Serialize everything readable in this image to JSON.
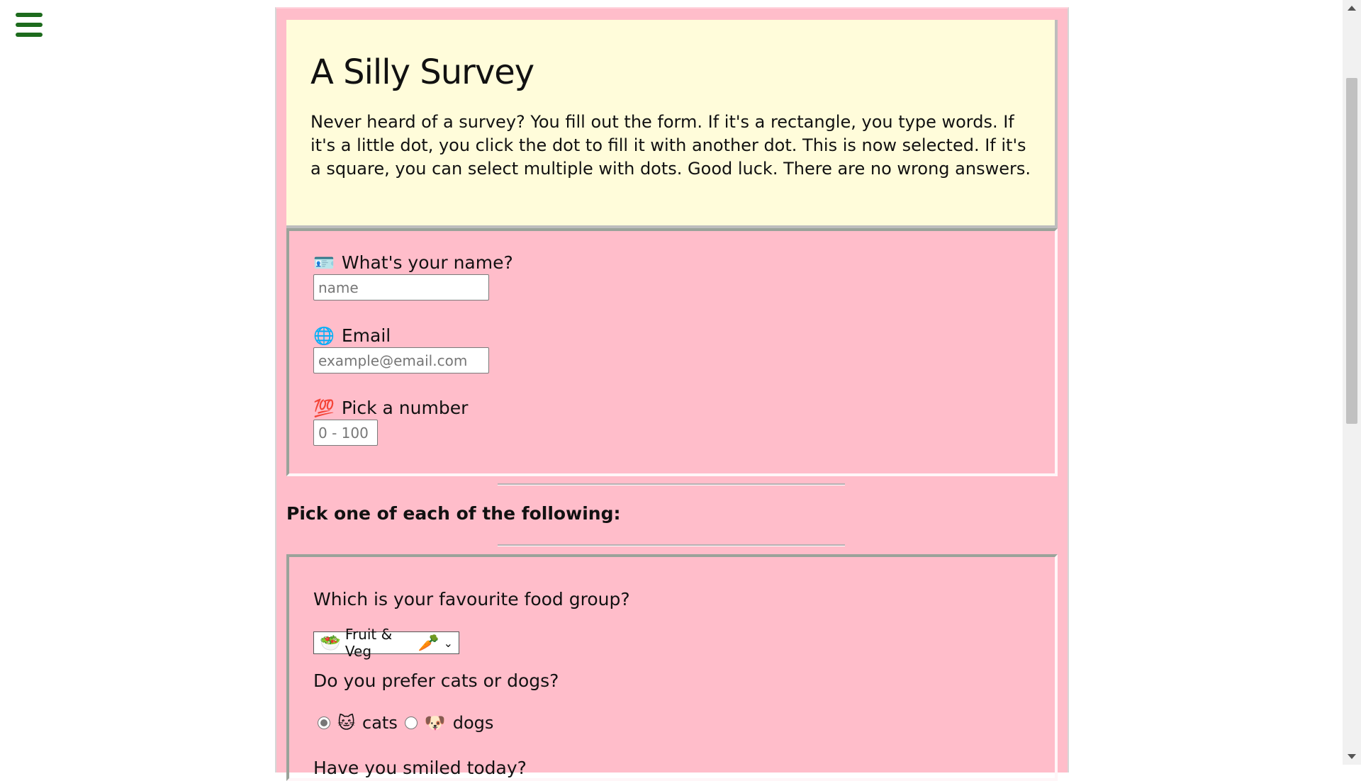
{
  "nav": {
    "menu_icon": "hamburger-menu-icon"
  },
  "intro": {
    "title": "A Silly Survey",
    "description": "Never heard of a survey? You fill out the form. If it's a rectangle, you type words. If it's a little dot, you click the dot to fill it with another dot. This is now selected. If it's a square, you can select multiple with dots. Good luck. There are no wrong answers."
  },
  "form": {
    "name": {
      "label": "What's your name?",
      "icon": "🪪",
      "placeholder": "name",
      "value": ""
    },
    "email": {
      "label": "Email",
      "icon": "🌐",
      "placeholder": "example@email.com",
      "value": ""
    },
    "number": {
      "label": "Pick a number",
      "icon": "💯",
      "placeholder": "0 - 100",
      "value": ""
    }
  },
  "section": {
    "title": "Pick one of each of the following:"
  },
  "questions": {
    "food": {
      "label": "Which is your favourite food group?",
      "selected": "Fruit & Veg",
      "icon_left": "🥗",
      "icon_right": "🥕"
    },
    "pets": {
      "label": "Do you prefer cats or dogs?",
      "options": [
        {
          "label": "cats",
          "icon": "🐱",
          "checked": true
        },
        {
          "label": "dogs",
          "icon": "🐶",
          "checked": false
        }
      ]
    },
    "smile": {
      "label": "Have you smiled today?"
    }
  },
  "colors": {
    "page_bg": "#ffbdca",
    "intro_bg": "#fffcda",
    "menu_icon": "#1d6b1d"
  }
}
